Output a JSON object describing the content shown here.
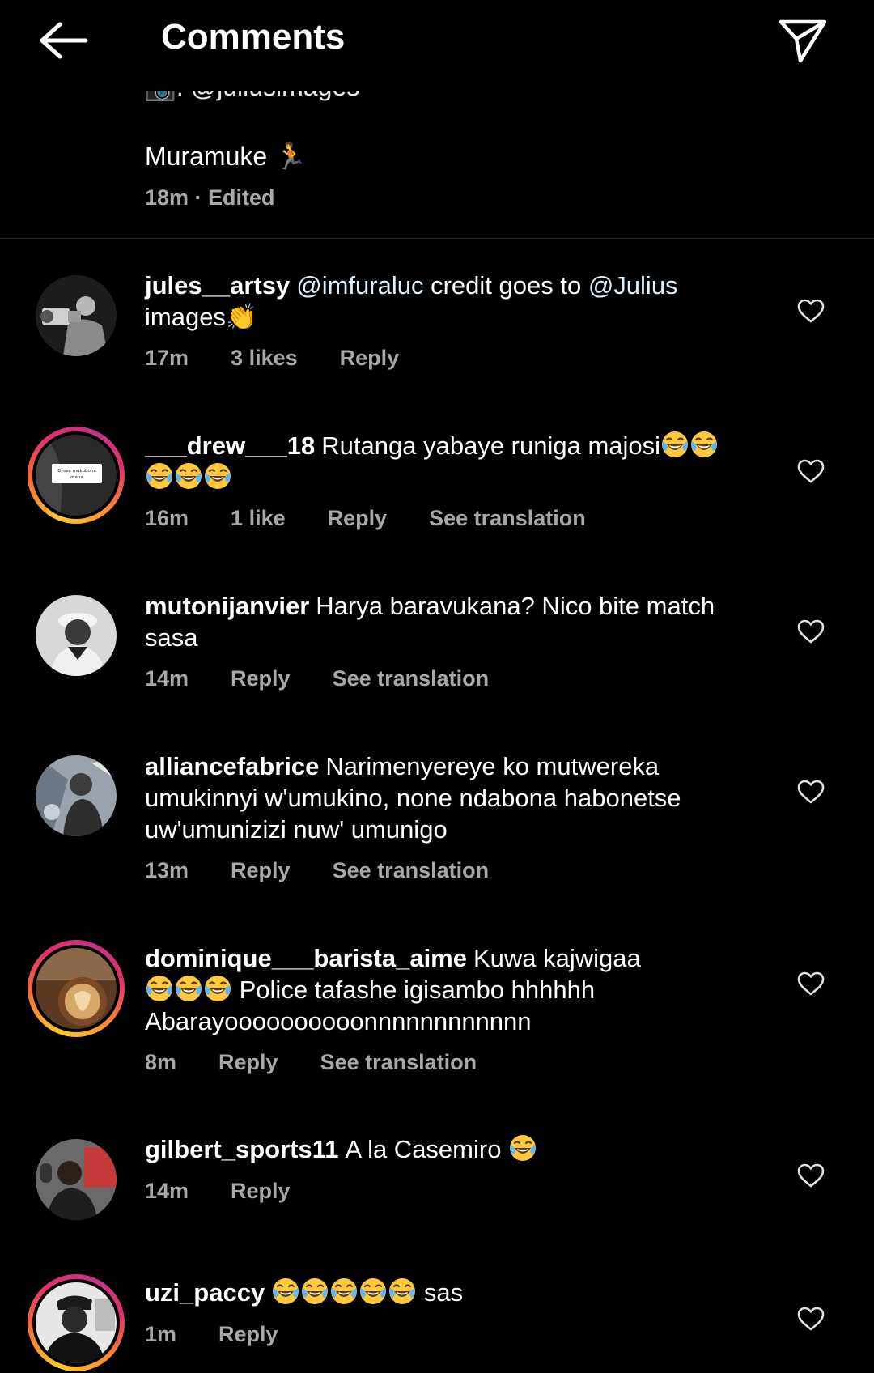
{
  "header": {
    "title": "Comments",
    "back_icon": "arrow-left-icon",
    "share_icon": "paper-plane-icon"
  },
  "caption": {
    "clipped_line": "📷: @juliusimages",
    "text": "Muramuke 🏃",
    "meta": "18m · Edited"
  },
  "comments": [
    {
      "username": "jules__artsy",
      "text": "credit goes to",
      "mention1": "@imfuraluc",
      "mention2": "@Julius",
      "text_after": "images",
      "emoji_after": "👏",
      "time": "17m",
      "likes": "3 likes",
      "reply": "Reply"
    },
    {
      "username": "___drew___18",
      "text": "Rutanga yabaye runiga majosi",
      "time": "16m",
      "likes": "1 like",
      "reply": "Reply",
      "see_translation": "See translation",
      "avatar_text": "Byose mukubona Imana."
    },
    {
      "username": "mutonijanvier",
      "text": "Harya baravukana? Nico bite match sasa",
      "time": "14m",
      "reply": "Reply",
      "see_translation": "See translation"
    },
    {
      "username": "alliancefabrice",
      "text": "Narimenyereye ko mutwereka umukinnyi w'umukino, none ndabona habonetse uw'umunizizi nuw' umunigo",
      "time": "13m",
      "reply": "Reply",
      "see_translation": "See translation"
    },
    {
      "username": "dominique___barista_aime",
      "text_before": "Kuwa kajwigaa",
      "text_after": "Police tafashe igisambo hhhhhh Abarayoooooooooonnnnnnnnnnnn",
      "time": "8m",
      "reply": "Reply",
      "see_translation": "See translation"
    },
    {
      "username": "gilbert_sports11",
      "text": "A la Casemiro",
      "time": "14m",
      "reply": "Reply"
    },
    {
      "username": "uzi_paccy",
      "text": "sas",
      "time": "1m",
      "reply": "Reply"
    }
  ],
  "colors": {
    "background": "#000000",
    "meta_text": "#a8a8a8",
    "divider": "#262626",
    "story_ring": [
      "#fdc830",
      "#f37335",
      "#e1306c",
      "#c13584"
    ]
  }
}
